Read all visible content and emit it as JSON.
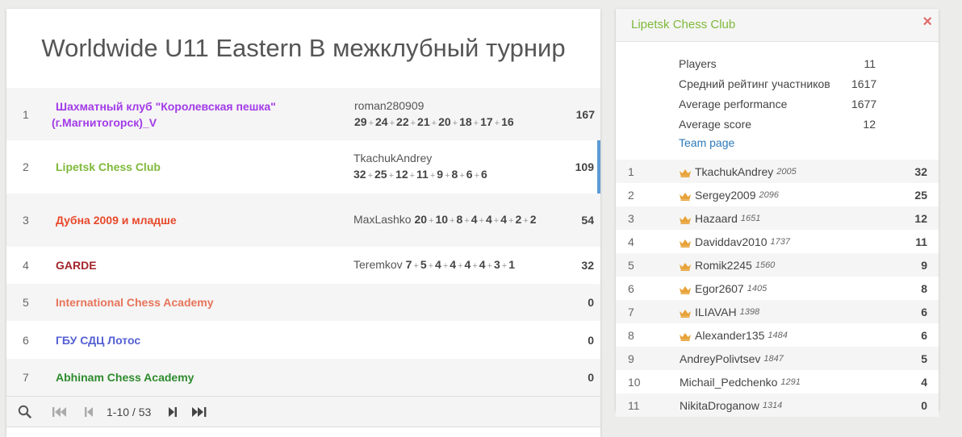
{
  "tournament_title": "Worldwide U11 Eastern B межклубный турнир",
  "standings": [
    {
      "rank": "1",
      "team": "Шахматный клуб \"Королевская пешка\" (г.Магнитогорск)_V",
      "team_color": "#a23ae8",
      "leader": "roman280909",
      "scores": [
        "29",
        "24",
        "22",
        "21",
        "20",
        "18",
        "17",
        "16"
      ],
      "total": "167"
    },
    {
      "rank": "2",
      "team": "Lipetsk Chess Club",
      "team_color": "#7fb93a",
      "leader": "TkachukAndrey",
      "scores": [
        "32",
        "25",
        "12",
        "11",
        "9",
        "8",
        "6",
        "6"
      ],
      "total": "109"
    },
    {
      "rank": "3",
      "team": "Дубна 2009 и младше",
      "team_color": "#e8492b",
      "leader": "MaxLashko",
      "scores": [
        "20",
        "10",
        "8",
        "4",
        "4",
        "4",
        "2",
        "2"
      ],
      "total": "54"
    },
    {
      "rank": "4",
      "team": "GARDE",
      "team_color": "#a3262c",
      "leader": "Teremkov",
      "scores": [
        "7",
        "5",
        "4",
        "4",
        "4",
        "4",
        "3",
        "1"
      ],
      "total": "32"
    },
    {
      "rank": "5",
      "team": "International Chess Academy",
      "team_color": "#e8745a",
      "leader": "",
      "scores": [],
      "total": "0"
    },
    {
      "rank": "6",
      "team": "ГБУ СДЦ Лотос",
      "team_color": "#5560d4",
      "leader": "",
      "scores": [],
      "total": "0"
    },
    {
      "rank": "7",
      "team": "Abhinam Chess Academy",
      "team_color": "#2e8b2e",
      "leader": "",
      "scores": [],
      "total": "0"
    }
  ],
  "pager": {
    "info": "1-10 / 53"
  },
  "team_panel": {
    "title": "Lipetsk Chess Club",
    "close": "×",
    "stats": [
      {
        "label": "Players",
        "value": "11"
      },
      {
        "label": "Средний рейтинг участников",
        "value": "1617"
      },
      {
        "label": "Average performance",
        "value": "1677"
      },
      {
        "label": "Average score",
        "value": "12"
      }
    ],
    "team_page_label": "Team page",
    "players": [
      {
        "rank": "1",
        "name": "TkachukAndrey",
        "rating": "2005",
        "score": "32",
        "crown": true
      },
      {
        "rank": "2",
        "name": "Sergey2009",
        "rating": "2096",
        "score": "25",
        "crown": true
      },
      {
        "rank": "3",
        "name": "Hazaard",
        "rating": "1651",
        "score": "12",
        "crown": true
      },
      {
        "rank": "4",
        "name": "Daviddav2010",
        "rating": "1737",
        "score": "11",
        "crown": true
      },
      {
        "rank": "5",
        "name": "Romik2245",
        "rating": "1560",
        "score": "9",
        "crown": true
      },
      {
        "rank": "6",
        "name": "Egor2607",
        "rating": "1405",
        "score": "8",
        "crown": true
      },
      {
        "rank": "7",
        "name": "ILIAVAH",
        "rating": "1398",
        "score": "6",
        "crown": true
      },
      {
        "rank": "8",
        "name": "Alexander135",
        "rating": "1484",
        "score": "6",
        "crown": true
      },
      {
        "rank": "9",
        "name": "AndreyPolivtsev",
        "rating": "1847",
        "score": "5",
        "crown": false
      },
      {
        "rank": "10",
        "name": "Michail_Pedchenko",
        "rating": "1291",
        "score": "4",
        "crown": false
      },
      {
        "rank": "11",
        "name": "NikitaDroganow",
        "rating": "1314",
        "score": "0",
        "crown": false
      }
    ]
  },
  "colors": {
    "accent": "#7fb93a",
    "link": "#2c79b8",
    "crown": "#e8a33a",
    "active_bar": "#5b9bd5",
    "close": "#e06b6b"
  }
}
